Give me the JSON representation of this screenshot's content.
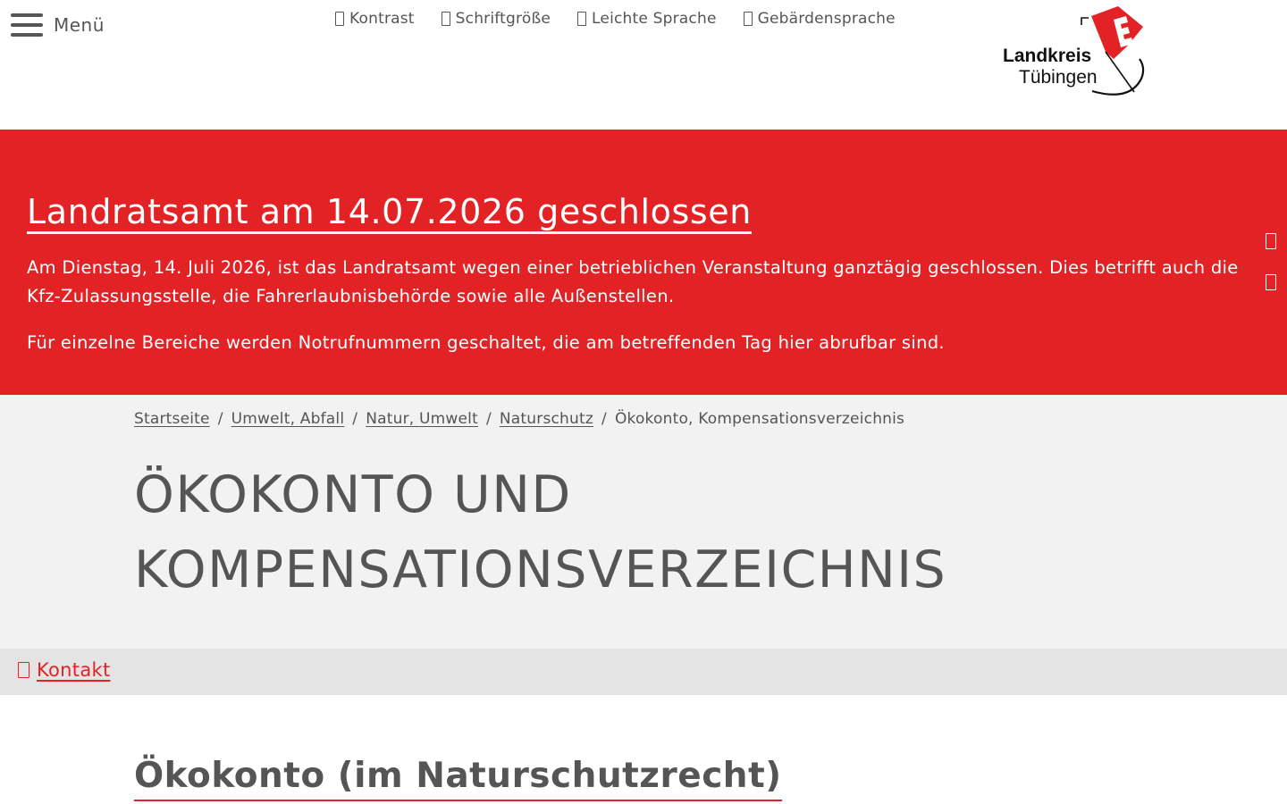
{
  "header": {
    "menu_label": "Menü",
    "tools": [
      {
        "label": "Kontrast",
        "icon": "contrast-icon"
      },
      {
        "label": "Schriftgröße",
        "icon": "font-size-icon"
      },
      {
        "label": "Leichte Sprache",
        "icon": "easy-language-icon"
      },
      {
        "label": "Gebärdensprache",
        "icon": "sign-language-icon"
      }
    ],
    "logo": {
      "line1": "Landkreis",
      "line2": "Tübingen",
      "flag_color": "#e32226"
    }
  },
  "alert": {
    "title": "Landratsamt am 14.07.2026 geschlossen",
    "paragraph1": "Am Dienstag, 14. Juli 2026, ist das Landratsamt wegen einer betrieblichen Veranstaltung ganztägig geschlossen. Dies betrifft auch die Kfz-Zulassungsstelle, die Fahrerlaubnisbehörde sowie alle Außenstellen.",
    "paragraph2": "Für einzelne Bereiche werden Notrufnummern geschaltet, die am betreffenden Tag hier abrufbar sind.",
    "background_color": "#e32226",
    "controls": [
      "chevron-up-icon",
      "chevron-down-icon"
    ]
  },
  "breadcrumb": {
    "items": [
      "Startseite",
      "Umwelt, Abfall",
      "Natur, Umwelt",
      "Naturschutz"
    ],
    "current": "Ökokonto, Kompensationsverzeichnis",
    "separator": "/"
  },
  "page": {
    "title_line1": "ÖKOKONTO UND",
    "title_line2": "KOMPENSATIONSVERZEICHNIS"
  },
  "contact": {
    "label": "Kontakt",
    "icon": "contact-icon",
    "color": "#e32226"
  },
  "section": {
    "title": "Ökokonto (im Naturschutzrecht)"
  }
}
